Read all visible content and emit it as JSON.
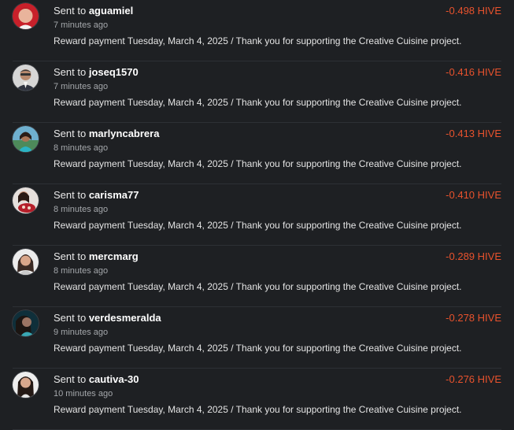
{
  "accent_color": "#e8522d",
  "transactions": [
    {
      "prefix": "Sent to",
      "user": "aguamiel",
      "time": "7 minutes ago",
      "amount": "-0.498 HIVE",
      "memo": "Reward payment Tuesday, March 4, 2025 / Thank you for supporting the Creative Cuisine project."
    },
    {
      "prefix": "Sent to",
      "user": "joseq1570",
      "time": "7 minutes ago",
      "amount": "-0.416 HIVE",
      "memo": "Reward payment Tuesday, March 4, 2025 / Thank you for supporting the Creative Cuisine project."
    },
    {
      "prefix": "Sent to",
      "user": "marlyncabrera",
      "time": "8 minutes ago",
      "amount": "-0.413 HIVE",
      "memo": "Reward payment Tuesday, March 4, 2025 / Thank you for supporting the Creative Cuisine project."
    },
    {
      "prefix": "Sent to",
      "user": "carisma77",
      "time": "8 minutes ago",
      "amount": "-0.410 HIVE",
      "memo": "Reward payment Tuesday, March 4, 2025 / Thank you for supporting the Creative Cuisine project."
    },
    {
      "prefix": "Sent to",
      "user": "mercmarg",
      "time": "8 minutes ago",
      "amount": "-0.289 HIVE",
      "memo": "Reward payment Tuesday, March 4, 2025 / Thank you for supporting the Creative Cuisine project."
    },
    {
      "prefix": "Sent to",
      "user": "verdesmeralda",
      "time": "9 minutes ago",
      "amount": "-0.278 HIVE",
      "memo": "Reward payment Tuesday, March 4, 2025 / Thank you for supporting the Creative Cuisine project."
    },
    {
      "prefix": "Sent to",
      "user": "cautiva-30",
      "time": "10 minutes ago",
      "amount": "-0.276 HIVE",
      "memo": "Reward payment Tuesday, March 4, 2025 / Thank you for supporting the Creative Cuisine project."
    }
  ]
}
